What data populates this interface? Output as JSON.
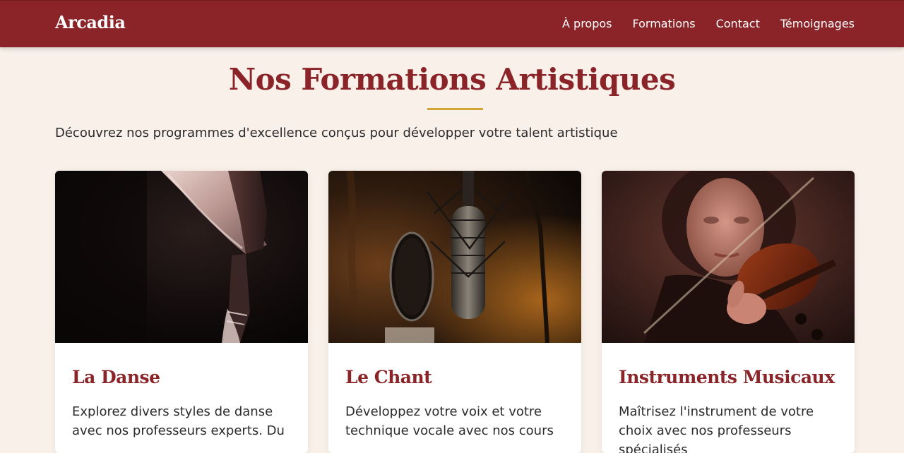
{
  "header": {
    "brand": "Arcadia",
    "nav": [
      "À propos",
      "Formations",
      "Contact",
      "Témoignages"
    ]
  },
  "section": {
    "title": "Nos Formations Artistiques",
    "subtitle": "Découvrez nos programmes d'excellence conçus pour développer votre talent artistique"
  },
  "cards": [
    {
      "title": "La Danse",
      "text": "Explorez divers styles de danse avec nos professeurs experts. Du",
      "image": "ballet-pointe-shoes-photo"
    },
    {
      "title": "Le Chant",
      "text": "Développez votre voix et votre technique vocale avec nos cours",
      "image": "studio-microphone-photo"
    },
    {
      "title": "Instruments Musicaux",
      "text": "Maîtrisez l'instrument de votre choix avec nos professeurs spécialisés",
      "image": "violinist-photo"
    }
  ],
  "colors": {
    "brand": "#8b2428",
    "background": "#f8f0e9",
    "accent": "#d4a637"
  }
}
